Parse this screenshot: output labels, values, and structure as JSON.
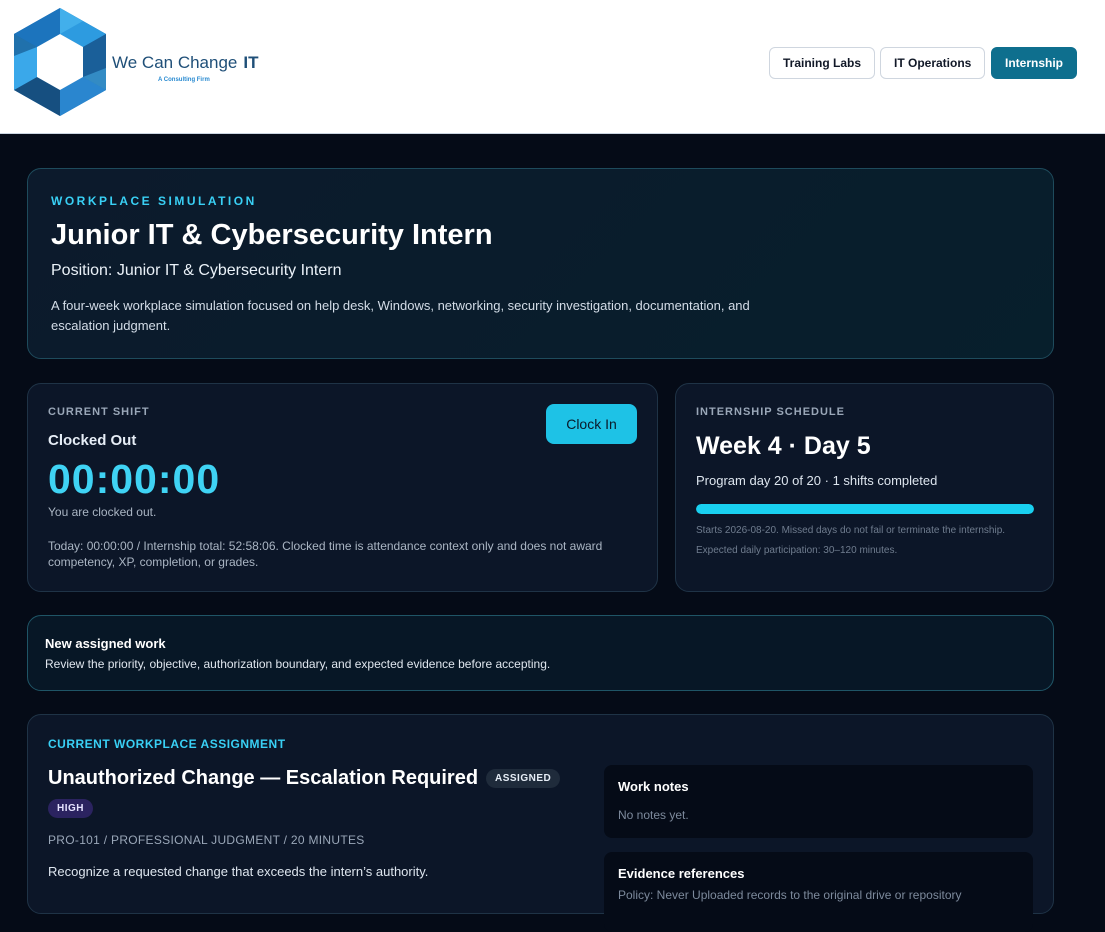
{
  "brand": {
    "name": "We Can Change",
    "suffix": "IT",
    "tagline": "A Consulting Firm"
  },
  "nav": [
    {
      "label": "Training Labs",
      "active": false
    },
    {
      "label": "IT Operations",
      "active": false
    },
    {
      "label": "Internship",
      "active": true
    }
  ],
  "hero": {
    "eyebrow": "WORKPLACE SIMULATION",
    "title": "Junior IT & Cybersecurity Intern",
    "position": "Position: Junior IT & Cybersecurity Intern",
    "description": "A four-week workplace simulation focused on help desk, Windows, networking, security investigation, documentation, and escalation judgment."
  },
  "shift": {
    "label": "CURRENT SHIFT",
    "status": "Clocked Out",
    "timer": "00:00:00",
    "message": "You are clocked out.",
    "note": "Today: 00:00:00 / Internship total: 52:58:06. Clocked time is attendance context only and does not award competency, XP, completion, or grades.",
    "button": "Clock In"
  },
  "schedule": {
    "label": "INTERNSHIP SCHEDULE",
    "week": "Week 4 · Day 5",
    "progress_text": "Program day 20 of 20 · 1 shifts completed",
    "progress_fraction": 1.0,
    "starts": "Starts 2026-08-20. Missed days do not fail or terminate the internship.",
    "expected": "Expected daily participation: 30–120 minutes."
  },
  "notice": {
    "title": "New assigned work",
    "description": "Review the priority, objective, authorization boundary, and expected evidence before accepting."
  },
  "assignment": {
    "label": "CURRENT WORKPLACE ASSIGNMENT",
    "title": "Unauthorized Change — Escalation Required",
    "status_badge": "ASSIGNED",
    "priority_badge": "HIGH",
    "meta": "PRO-101 / PROFESSIONAL JUDGMENT / 20 MINUTES",
    "objective": "Recognize a requested change that exceeds the intern’s authority.",
    "work_notes_title": "Work notes",
    "work_notes_body": "No notes yet.",
    "evidence_title": "Evidence references",
    "evidence_body": "Policy: Never Uploaded records to the original drive or repository"
  },
  "colors": {
    "accent": "#1ec2e6",
    "timer": "#3fd3f4",
    "nav_active": "#0e6f8e",
    "badge_high": "#2b2360"
  }
}
